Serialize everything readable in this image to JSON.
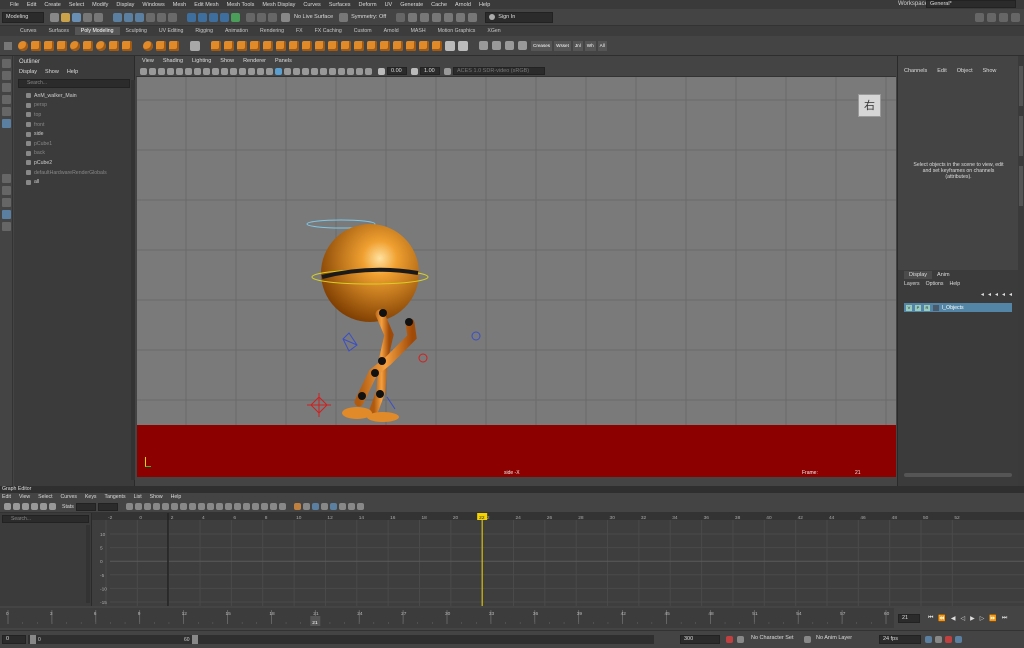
{
  "menubar": [
    "File",
    "Edit",
    "Create",
    "Select",
    "Modify",
    "Display",
    "Windows",
    "Mesh",
    "Edit Mesh",
    "Mesh Tools",
    "Mesh Display",
    "Curves",
    "Surfaces",
    "Deform",
    "UV",
    "Generate",
    "Cache",
    "Arnold",
    "Help"
  ],
  "workspace": {
    "label": "Workspace:",
    "value": "General*"
  },
  "status": {
    "mode": "Modeling",
    "live_surface": "No Live Surface",
    "symmetry": "Symmetry: Off",
    "sign_in": "Sign In"
  },
  "shelf_tabs": [
    "Curves",
    "Surfaces",
    "Poly Modeling",
    "Sculpting",
    "UV Editing",
    "Rigging",
    "Animation",
    "Rendering",
    "FX",
    "FX Caching",
    "Custom",
    "Arnold",
    "MASH",
    "Motion Graphics",
    "XGen"
  ],
  "shelf_active": "Poly Modeling",
  "shelf_labels": [
    "Creases",
    "Wsset",
    "Jnl",
    "Wh",
    "All"
  ],
  "outliner": {
    "title": "Outliner",
    "menu": [
      "Display",
      "Show",
      "Help"
    ],
    "search_placeholder": "Search...",
    "items": [
      {
        "label": "AnM_walker_Main",
        "dim": false
      },
      {
        "label": "persp",
        "dim": true
      },
      {
        "label": "top",
        "dim": true
      },
      {
        "label": "front",
        "dim": true
      },
      {
        "label": "side",
        "dim": false
      },
      {
        "label": "pCube1",
        "dim": true
      },
      {
        "label": "back",
        "dim": true
      },
      {
        "label": "pCube2",
        "dim": false
      },
      {
        "label": "defaultHardwareRenderGlobals",
        "dim": true
      },
      {
        "label": "all",
        "dim": false
      }
    ]
  },
  "viewport": {
    "menu": [
      "View",
      "Shading",
      "Lighting",
      "Show",
      "Renderer",
      "Panels"
    ],
    "field1": "0.00",
    "field2": "1.00",
    "color_space": "ACES 1.0 SDR-video (sRGB)",
    "viewcube_label": "右",
    "camera_label": "side -X",
    "frame_label": "Frame:",
    "frame_value": "21"
  },
  "channels": {
    "menu": [
      "Channels",
      "Edit",
      "Object",
      "Show"
    ],
    "message": "Select objects in the scene to view, edit and set keyframes on channels (attributes)."
  },
  "layers": {
    "tabs": [
      "Display",
      "Anim"
    ],
    "menu": [
      "Layers",
      "Options",
      "Help"
    ],
    "row_flags": [
      "V",
      "P",
      "R"
    ],
    "layer_name": "l_Objects"
  },
  "graph_editor": {
    "title": "Graph Editor",
    "menu": [
      "Edit",
      "View",
      "Select",
      "Curves",
      "Keys",
      "Tangents",
      "List",
      "Show",
      "Help"
    ],
    "stats_label": "Stats",
    "search_placeholder": "Search...",
    "frame_ticks": [
      "-2",
      "0",
      "2",
      "4",
      "6",
      "8",
      "10",
      "12",
      "14",
      "16",
      "18",
      "20",
      "22",
      "24",
      "26",
      "28",
      "30",
      "32",
      "34",
      "36",
      "38",
      "40",
      "42",
      "44",
      "46",
      "48",
      "50",
      "52"
    ],
    "value_ticks": [
      "10",
      "5",
      "0",
      "-5",
      "-10",
      "-15"
    ],
    "current_frame": "22"
  },
  "timeline": {
    "ticks": [
      "0",
      "3",
      "6",
      "9",
      "12",
      "15",
      "18",
      "21",
      "24",
      "27",
      "30",
      "33",
      "36",
      "39",
      "42",
      "45",
      "48",
      "51",
      "54",
      "57",
      "60"
    ],
    "current_frame": "21",
    "current_frame_field": "21"
  },
  "range": {
    "start": "0",
    "range_start": "0",
    "range_end": "60",
    "end": "300",
    "character_set": "No Character Set",
    "anim_layer": "No Anim Layer",
    "fps": "24 fps"
  },
  "colors": {
    "accent_orange": "#e08a2a",
    "ground_red": "#8c0000",
    "timeline_marker": "#f5d400",
    "layer_blue": "#5285a6"
  }
}
